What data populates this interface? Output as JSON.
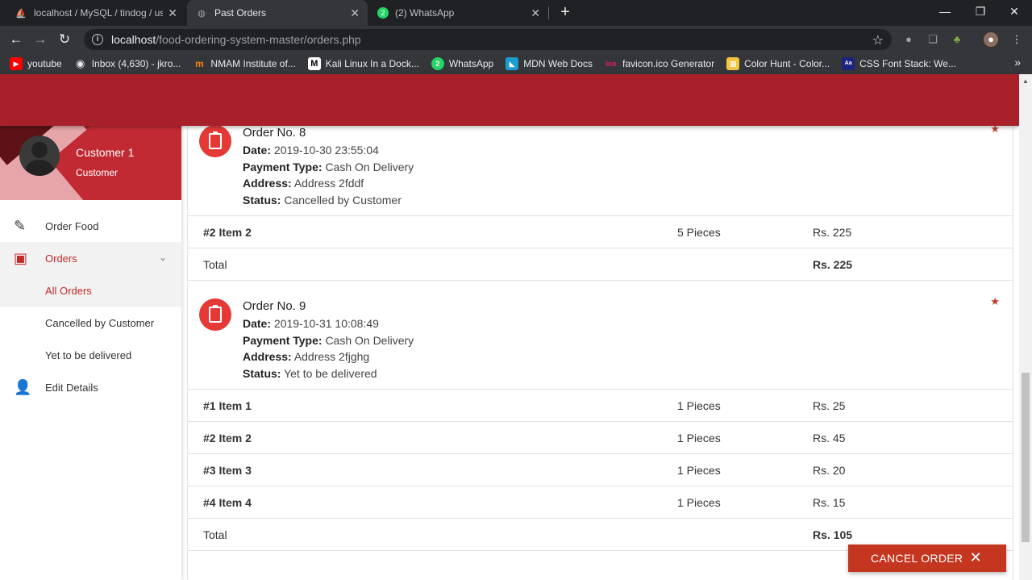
{
  "browser": {
    "tabs": [
      {
        "title": "localhost / MySQL / tindog / use",
        "active": false
      },
      {
        "title": "Past Orders",
        "active": true
      },
      {
        "title": "(2) WhatsApp",
        "active": false
      }
    ],
    "url_host": "localhost",
    "url_path": "/food-ordering-system-master/orders.php",
    "bookmarks": [
      {
        "label": "youtube",
        "icon": "youtube-icon",
        "color": "#ff0000"
      },
      {
        "label": "Inbox (4,630) - jkro...",
        "icon": "globe-icon",
        "color": "#e8eaed"
      },
      {
        "label": "NMAM Institute of...",
        "icon": "moodle-icon",
        "color": "#f98012"
      },
      {
        "label": "Kali Linux In a Dock...",
        "icon": "medium-icon",
        "color": "#000000"
      },
      {
        "label": "WhatsApp",
        "icon": "whatsapp-icon",
        "color": "#25d366"
      },
      {
        "label": "MDN Web Docs",
        "icon": "mdn-icon",
        "color": "#1b9ecf"
      },
      {
        "label": "favicon.ico Generator",
        "icon": "favicon-icon",
        "color": "#c2185b"
      },
      {
        "label": "Color Hunt - Color...",
        "icon": "colorhunt-icon",
        "color": "#f4c542"
      },
      {
        "label": "CSS Font Stack: We...",
        "icon": "cssfont-icon",
        "color": "#1a237e"
      }
    ]
  },
  "user": {
    "name": "Customer 1",
    "role": "Customer"
  },
  "menu": {
    "order_food": "Order Food",
    "orders": "Orders",
    "all_orders": "All Orders",
    "cancelled": "Cancelled by Customer",
    "yet": "Yet to be delivered",
    "edit": "Edit Details"
  },
  "labels": {
    "date": "Date:",
    "payment": "Payment Type:",
    "address": "Address:",
    "status": "Status:",
    "total": "Total"
  },
  "orders": [
    {
      "title": "Order No. 8",
      "date": "2019-10-30 23:55:04",
      "payment": "Cash On Delivery",
      "address": "Address 2fddf",
      "status": "Cancelled by Customer",
      "items": [
        {
          "num": "#2",
          "name": "Item 2",
          "qty": "5 Pieces",
          "price": "Rs. 225"
        }
      ],
      "total": "Rs. 225"
    },
    {
      "title": "Order No. 9",
      "date": "2019-10-31 10:08:49",
      "payment": "Cash On Delivery",
      "address": "Address 2fjghg",
      "status": "Yet to be delivered",
      "items": [
        {
          "num": "#1",
          "name": "Item 1",
          "qty": "1 Pieces",
          "price": "Rs. 25"
        },
        {
          "num": "#2",
          "name": "Item 2",
          "qty": "1 Pieces",
          "price": "Rs. 45"
        },
        {
          "num": "#3",
          "name": "Item 3",
          "qty": "1 Pieces",
          "price": "Rs. 20"
        },
        {
          "num": "#4",
          "name": "Item 4",
          "qty": "1 Pieces",
          "price": "Rs. 15"
        }
      ],
      "total": "Rs. 105"
    }
  ],
  "cancel_button": "CANCEL ORDER",
  "colors": {
    "header": "#a8212a",
    "accent": "#c62828",
    "cancel": "#c4361f",
    "icon_circle": "#e53935"
  }
}
